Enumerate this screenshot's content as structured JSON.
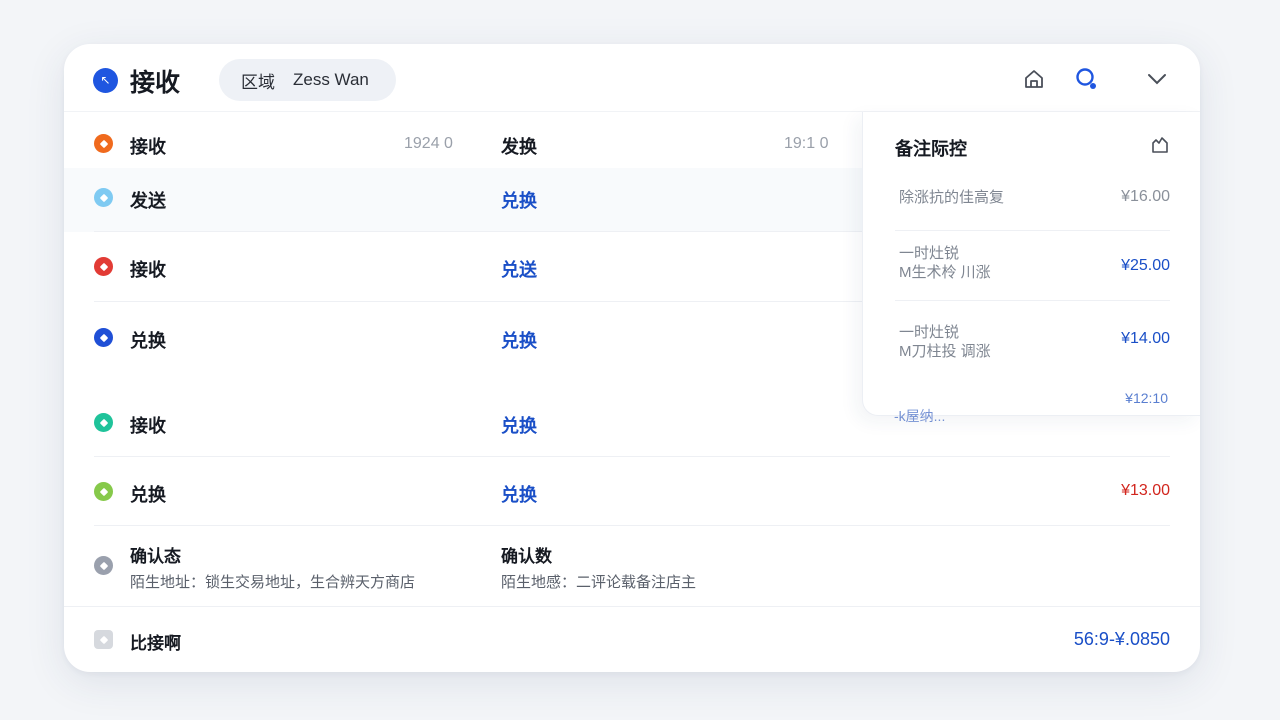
{
  "header": {
    "title": "接收",
    "user_label": "区域",
    "user_name": "Zess Wan",
    "icons": [
      "home-icon",
      "user-search-icon",
      "chevron-down-icon"
    ]
  },
  "rows": [
    {
      "label": "接收",
      "time_left": "1924 0",
      "mid": "发换",
      "time_right": "19:1 0",
      "dot_color": "#f06a1d"
    },
    {
      "label": "发送",
      "mid": "兑换",
      "dot_color": "#7fcaf2"
    },
    {
      "label": "接收",
      "mid": "兑送",
      "dot_color": "#e23b35"
    },
    {
      "label": "兑换",
      "mid": "兑换",
      "dot_color": "#1f4fd6"
    },
    {
      "label": "接收",
      "mid": "兑换",
      "dot_color": "#1fc39a"
    },
    {
      "label": "兑换",
      "mid": "兑换",
      "price": "¥13.00",
      "price_color": "#d2261e",
      "dot_color": "#86c94a"
    }
  ],
  "confirm": {
    "label": "确认态",
    "address": "陌生地址：锁生交易地址，生合辨天方商店",
    "mid_label": "确认数",
    "mid_address": "陌生地感：二评论载备注店主",
    "dot_color": "#9aa0ad"
  },
  "panel": {
    "title": "备注际控",
    "items": [
      {
        "line1": "除涨抗的佳高复",
        "line2": "",
        "price": "¥16.00",
        "price_color": "#8a909a"
      },
      {
        "line1": "一时灶锐",
        "line2": "M生术柃 川涨",
        "price": "¥25.00",
        "price_color": "#1a4fc7"
      },
      {
        "line1": "一时灶锐",
        "line2": "M刀柱投 调涨",
        "price": "¥14.00",
        "price_color": "#1a4fc7"
      }
    ],
    "overflow_price": "¥12:10",
    "overflow_text": "-k屋纳..."
  },
  "footer": {
    "label": "比接啊",
    "total": "56:9-¥.0850",
    "total_color": "#1a4fc7"
  }
}
